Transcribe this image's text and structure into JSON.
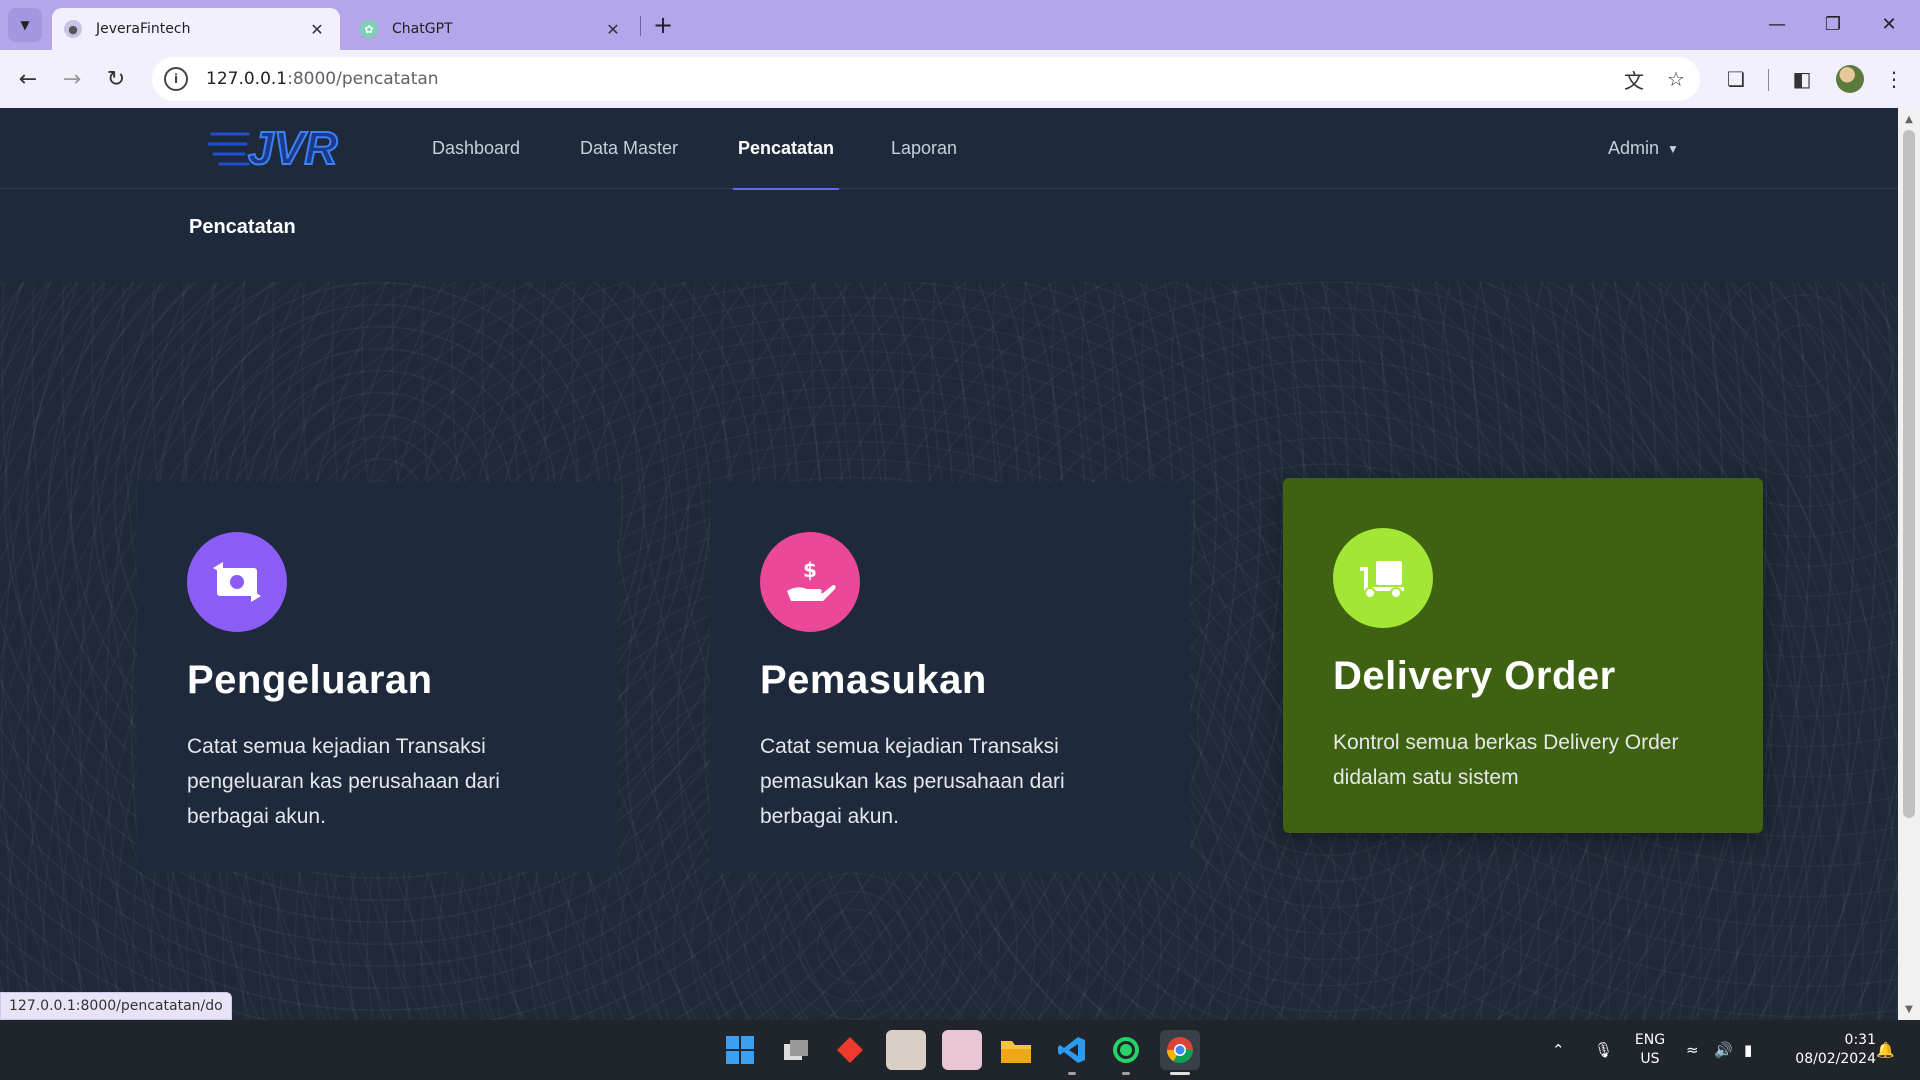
{
  "browser": {
    "tabs": [
      {
        "title": "JeveraFintech",
        "active": true
      },
      {
        "title": "ChatGPT",
        "active": false
      }
    ],
    "url_host": "127.0.0.1",
    "url_path": ":8000/pencatatan",
    "status_url": "127.0.0.1:8000/pencatatan/do"
  },
  "app": {
    "logo_text": "JVR",
    "nav": [
      {
        "label": "Dashboard",
        "active": false
      },
      {
        "label": "Data Master",
        "active": false
      },
      {
        "label": "Pencatatan",
        "active": true
      },
      {
        "label": "Laporan",
        "active": false
      }
    ],
    "user_menu": "Admin",
    "page_title": "Pencatatan"
  },
  "cards": [
    {
      "title": "Pengeluaran",
      "description": "Catat semua kejadian Transaksi pengeluaran kas perusahaan dari berbagai akun.",
      "icon": "money-exchange-icon",
      "icon_color": "#8b5cf6",
      "highlighted": false
    },
    {
      "title": "Pemasukan",
      "description": "Catat semua kejadian Transaksi pemasukan kas perusahaan dari berbagai akun.",
      "icon": "hand-dollar-icon",
      "icon_color": "#ec4899",
      "highlighted": false
    },
    {
      "title": "Delivery Order",
      "description": "Kontrol semua berkas Delivery Order didalam satu sistem",
      "icon": "delivery-truck-icon",
      "icon_color": "#a3e635",
      "highlighted": true,
      "highlight_color": "#3f6212"
    }
  ],
  "taskbar": {
    "lang_line1": "ENG",
    "lang_line2": "US",
    "time": "0:31",
    "date": "08/02/2024"
  }
}
